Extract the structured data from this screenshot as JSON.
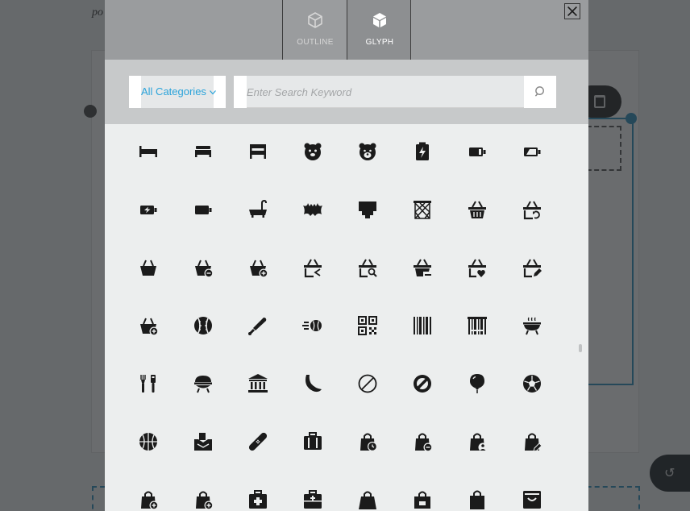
{
  "background": {
    "partial_text": "po"
  },
  "modal": {
    "tabs": [
      {
        "label": "OUTLINE",
        "icon": "outline-cube-icon",
        "active": false
      },
      {
        "label": "GLYPH",
        "icon": "glyph-cube-icon",
        "active": true
      }
    ],
    "close_icon": "close-icon",
    "category_select": {
      "value": "All Categories",
      "icon": "chevron-down-icon"
    },
    "search": {
      "placeholder": "Enter Search Keyword",
      "value": "",
      "icon": "search-icon"
    },
    "colors": {
      "accent": "#2aa3da",
      "header": "#9a9c9e",
      "search_band": "#c7c9ca",
      "grid_bg": "#eceeee",
      "icon": "#1b1b1b"
    }
  },
  "icons": [
    [
      "bed-single-icon",
      "bed-double-icon",
      "bunk-bed-icon",
      "bear-face-icon",
      "teddy-bear-icon",
      "battery-charging-icon",
      "battery-full-icon",
      "battery-low-icon"
    ],
    [
      "battery-charge-horizontal-icon",
      "battery-empty-icon",
      "bathtub-icon",
      "batman-icon",
      "bath-mat-icon",
      "basketball-net-icon",
      "basket-icon",
      "basket-refresh-icon"
    ],
    [
      "basket-check-icon",
      "basket-minus-icon",
      "basket-add-icon",
      "basket-share-icon",
      "basket-search-icon",
      "basket-remove-icon",
      "basket-heart-icon",
      "basket-edit-icon"
    ],
    [
      "basket-plus-icon",
      "baseball-icon",
      "baseball-bat-icon",
      "baseball-pitch-icon",
      "qr-code-icon",
      "barcode-icon",
      "barcode-scan-icon",
      "barbecue-grill-icon"
    ],
    [
      "barbecue-tools-icon",
      "grill-icon",
      "bank-icon",
      "banana-icon",
      "ban-outline-icon",
      "ban-icon",
      "balloon-icon",
      "soccer-ball-icon"
    ],
    [
      "basketball-icon",
      "ballot-box-icon",
      "bandage-icon",
      "luggage-icon",
      "bag-clock-icon",
      "bag-minus-icon",
      "bag-person-icon",
      "bag-edit-icon"
    ],
    [
      "bag-add-icon",
      "bag-plus-icon",
      "first-aid-kit-icon",
      "medical-kit-icon",
      "shopping-bag-icon",
      "bag-lock-icon",
      "bag-icon",
      "archive-box-icon"
    ]
  ]
}
